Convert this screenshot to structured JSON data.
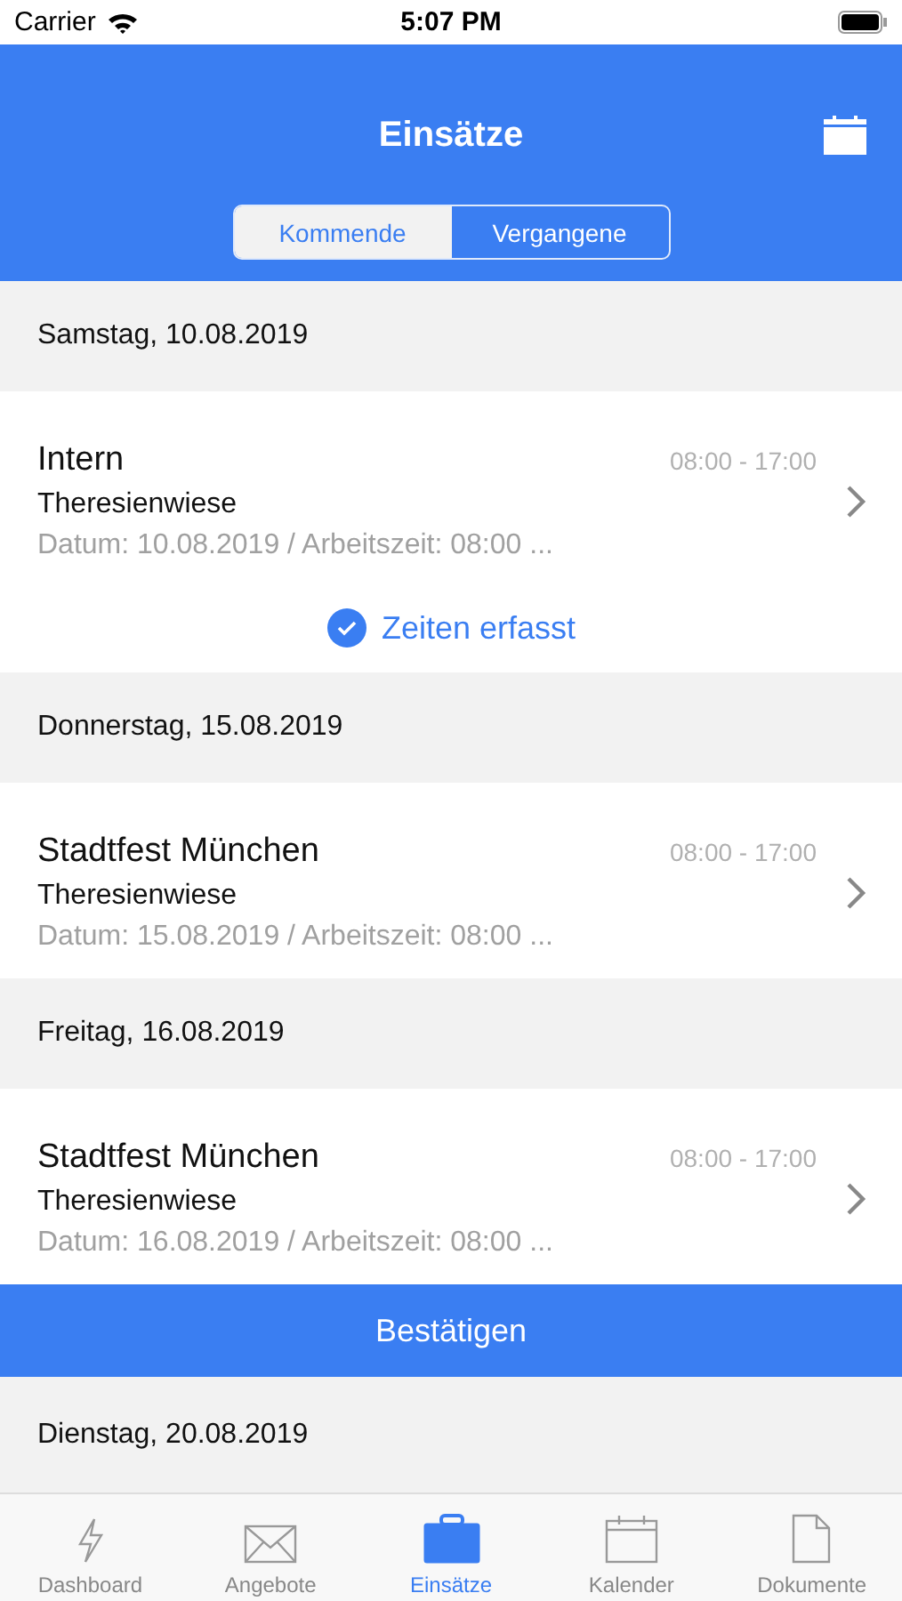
{
  "status_bar": {
    "carrier": "Carrier",
    "time": "5:07 PM"
  },
  "header": {
    "title": "Einsätze"
  },
  "segments": [
    {
      "label": "Kommende",
      "selected": true
    },
    {
      "label": "Vergangene",
      "selected": false
    }
  ],
  "list": [
    {
      "kind": "section",
      "label": "Samstag, 10.08.2019"
    },
    {
      "kind": "entry",
      "title": "Intern",
      "time": "08:00 - 17:00",
      "location": "Theresienwiese",
      "details": "Datum: 10.08.2019 / Arbeitszeit: 08:00 ...",
      "status": "Zeiten erfasst"
    },
    {
      "kind": "section",
      "label": "Donnerstag, 15.08.2019"
    },
    {
      "kind": "entry",
      "title": "Stadtfest München",
      "time": "08:00 - 17:00",
      "location": "Theresienwiese",
      "details": "Datum: 15.08.2019 / Arbeitszeit: 08:00 ..."
    },
    {
      "kind": "section",
      "label": "Freitag, 16.08.2019"
    },
    {
      "kind": "entry",
      "title": "Stadtfest München",
      "time": "08:00 - 17:00",
      "location": "Theresienwiese",
      "details": "Datum: 16.08.2019 / Arbeitszeit: 08:00 ..."
    },
    {
      "kind": "button",
      "label": "Bestätigen"
    },
    {
      "kind": "section",
      "label": "Dienstag, 20.08.2019"
    }
  ],
  "tab_bar": [
    {
      "label": "Dashboard",
      "kind": "bolt",
      "selected": false
    },
    {
      "label": "Angebote",
      "kind": "mail",
      "selected": false
    },
    {
      "label": "Einsätze",
      "kind": "briefcase",
      "selected": true
    },
    {
      "label": "Kalender",
      "kind": "calendar",
      "selected": false
    },
    {
      "label": "Dokumente",
      "kind": "document",
      "selected": false
    }
  ]
}
